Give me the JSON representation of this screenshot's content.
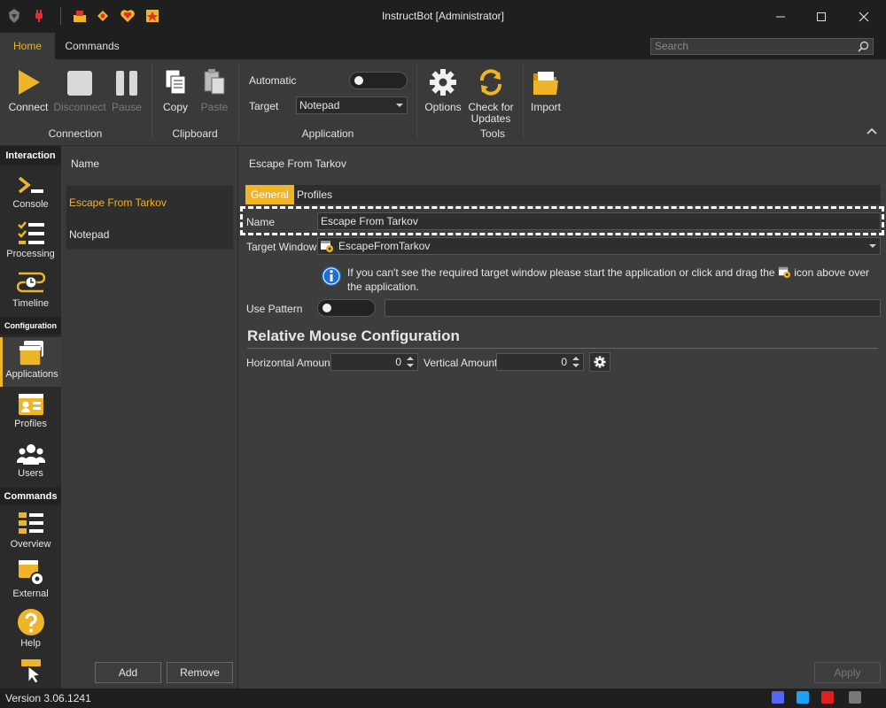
{
  "window": {
    "title": "InstructBot [Administrator]"
  },
  "ribbon_tabs": [
    {
      "label": "Home"
    },
    {
      "label": "Commands"
    }
  ],
  "search": {
    "placeholder": "Search"
  },
  "ribbon": {
    "connection": {
      "group_label": "Connection",
      "connect": "Connect",
      "disconnect": "Disconnect",
      "pause": "Pause"
    },
    "clipboard": {
      "group_label": "Clipboard",
      "copy": "Copy",
      "paste": "Paste"
    },
    "application": {
      "group_label": "Application",
      "automatic_label": "Automatic",
      "automatic_on": false,
      "target_label": "Target",
      "target_value": "Notepad"
    },
    "tools": {
      "group_label": "Tools",
      "options": "Options",
      "check_updates_line1": "Check for",
      "check_updates_line2": "Updates"
    },
    "import": "Import"
  },
  "nav": {
    "interaction_header": "Interaction",
    "configuration_header": "Configuration",
    "commands_header": "Commands",
    "items": [
      {
        "label": "Console"
      },
      {
        "label": "Processing"
      },
      {
        "label": "Timeline"
      },
      {
        "label": "Applications"
      },
      {
        "label": "Profiles"
      },
      {
        "label": "Users"
      },
      {
        "label": "Overview"
      },
      {
        "label": "External"
      },
      {
        "label": "Help"
      }
    ]
  },
  "list": {
    "header": "Name",
    "items": [
      "Escape From Tarkov",
      "Notepad"
    ],
    "add": "Add",
    "remove": "Remove"
  },
  "detail": {
    "title": "Escape From Tarkov",
    "tabs": [
      "General",
      "Profiles"
    ],
    "name_label": "Name",
    "name_value": "Escape From Tarkov",
    "target_window_label": "Target Window",
    "target_window_value": "EscapeFromTarkov",
    "info_text_1": "If you can't see the required target window please start the application or click and drag the",
    "info_text_2": "icon above over the",
    "info_text_3": "application.",
    "use_pattern_label": "Use Pattern",
    "use_pattern_on": false,
    "section_title": "Relative Mouse Configuration",
    "horizontal_label": "Horizontal Amount",
    "horizontal_value": "0",
    "vertical_label": "Vertical Amount",
    "vertical_value": "0",
    "apply": "Apply"
  },
  "status": {
    "version": "Version 3.06.1241"
  },
  "colors": {
    "accent": "#f0b428",
    "background": "#3d3d3d",
    "dark": "#1f1f1f"
  }
}
